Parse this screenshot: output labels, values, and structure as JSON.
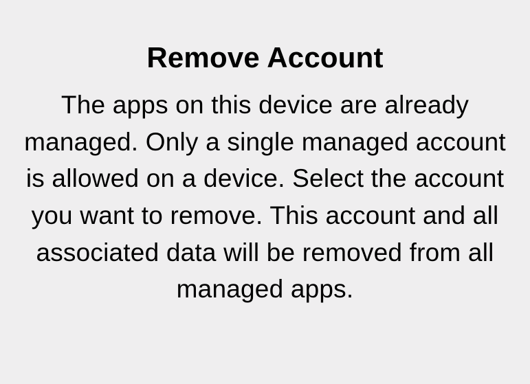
{
  "dialog": {
    "title": "Remove Account",
    "message": "The apps on this device are already managed.  Only a single managed account is allowed on a device. Select the account you want to remove.  This account and all associated data will be removed from all managed apps."
  }
}
